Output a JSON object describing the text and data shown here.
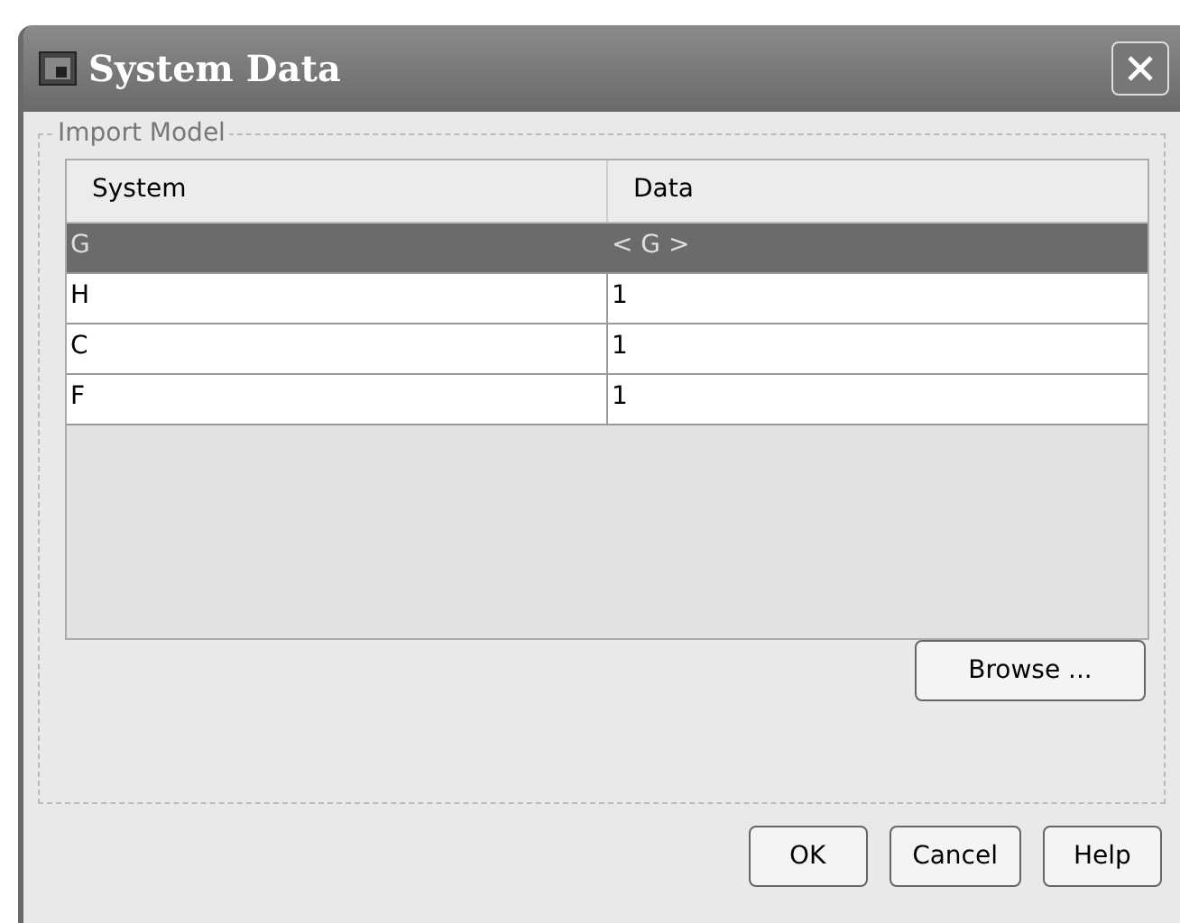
{
  "window": {
    "title": "System Data"
  },
  "group": {
    "title": "Import Model"
  },
  "table": {
    "columns": [
      "System",
      "Data"
    ],
    "rows": [
      {
        "cells": [
          "G",
          "< G >"
        ],
        "selected": true
      },
      {
        "cells": [
          "H",
          "1"
        ],
        "selected": false
      },
      {
        "cells": [
          "C",
          "1"
        ],
        "selected": false
      },
      {
        "cells": [
          "F",
          "1"
        ],
        "selected": false
      }
    ]
  },
  "browse_button": "Browse ...",
  "buttons": [
    "OK",
    "Cancel",
    "Help"
  ]
}
